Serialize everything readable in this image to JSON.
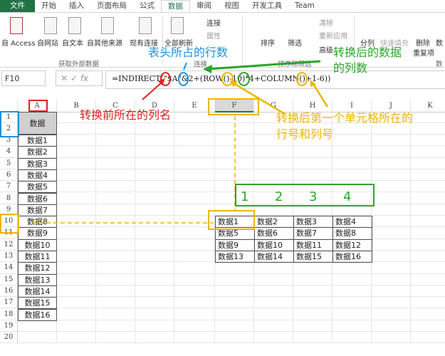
{
  "tabs": [
    "文件",
    "开始",
    "插入",
    "页面布局",
    "公式",
    "数据",
    "审阅",
    "视图",
    "开发工具",
    "Team"
  ],
  "ribbon": {
    "buttons": [
      "自 Access",
      "自网站",
      "自文本",
      "自其他来源",
      "现有连接",
      "全部刷新",
      "连接",
      "属性",
      "排序",
      "筛选",
      "清除",
      "重新应用",
      "高级",
      "分列",
      "快速填充",
      "删除",
      "重复项",
      "数"
    ],
    "groups": [
      "获取外部数据",
      "连接",
      "排序和筛选",
      "数"
    ]
  },
  "formula_bar": {
    "name_box": "F10",
    "fx": "fx",
    "formula": "=INDIRECT(\"$A\"&2+(ROW()-10)*4+COLUMN()+1-6))"
  },
  "columns": [
    "A",
    "B",
    "C",
    "D",
    "E",
    "F",
    "G",
    "H",
    "I",
    "J",
    "K"
  ],
  "rows": [
    "1",
    "2",
    "3",
    "4",
    "5",
    "6",
    "7",
    "8",
    "9",
    "10",
    "11",
    "12",
    "13",
    "14",
    "15",
    "16",
    "17",
    "18",
    "19",
    "20"
  ],
  "column_a": {
    "header": "数据",
    "values": [
      "数据1",
      "数据2",
      "数据3",
      "数据4",
      "数据5",
      "数据6",
      "数据7",
      "数据8",
      "数据9",
      "数据10",
      "数据11",
      "数据12",
      "数据13",
      "数据14",
      "数据15",
      "数据16"
    ]
  },
  "result_table": [
    [
      "数据1",
      "数据2",
      "数据3",
      "数据4"
    ],
    [
      "数据5",
      "数据6",
      "数据7",
      "数据8"
    ],
    [
      "数据9",
      "数据10",
      "数据11",
      "数据12"
    ],
    [
      "数据13",
      "数据14",
      "数据15",
      "数据16"
    ]
  ],
  "column_numbers": [
    "1",
    "2",
    "3",
    "4"
  ],
  "annotations": {
    "header_rows": "表头所占的行数",
    "result_cols_1": "转换后的数据",
    "result_cols_2": "的列数",
    "source_col": "转换前所在的列名",
    "first_cell_1": "转换后第一个单元格所在的",
    "first_cell_2": "行号和列号"
  },
  "colors": {
    "excel_green": "#217346",
    "red": "#e02020",
    "blue": "#1e90e0",
    "green": "#2aa52a",
    "orange": "#f0b400"
  }
}
